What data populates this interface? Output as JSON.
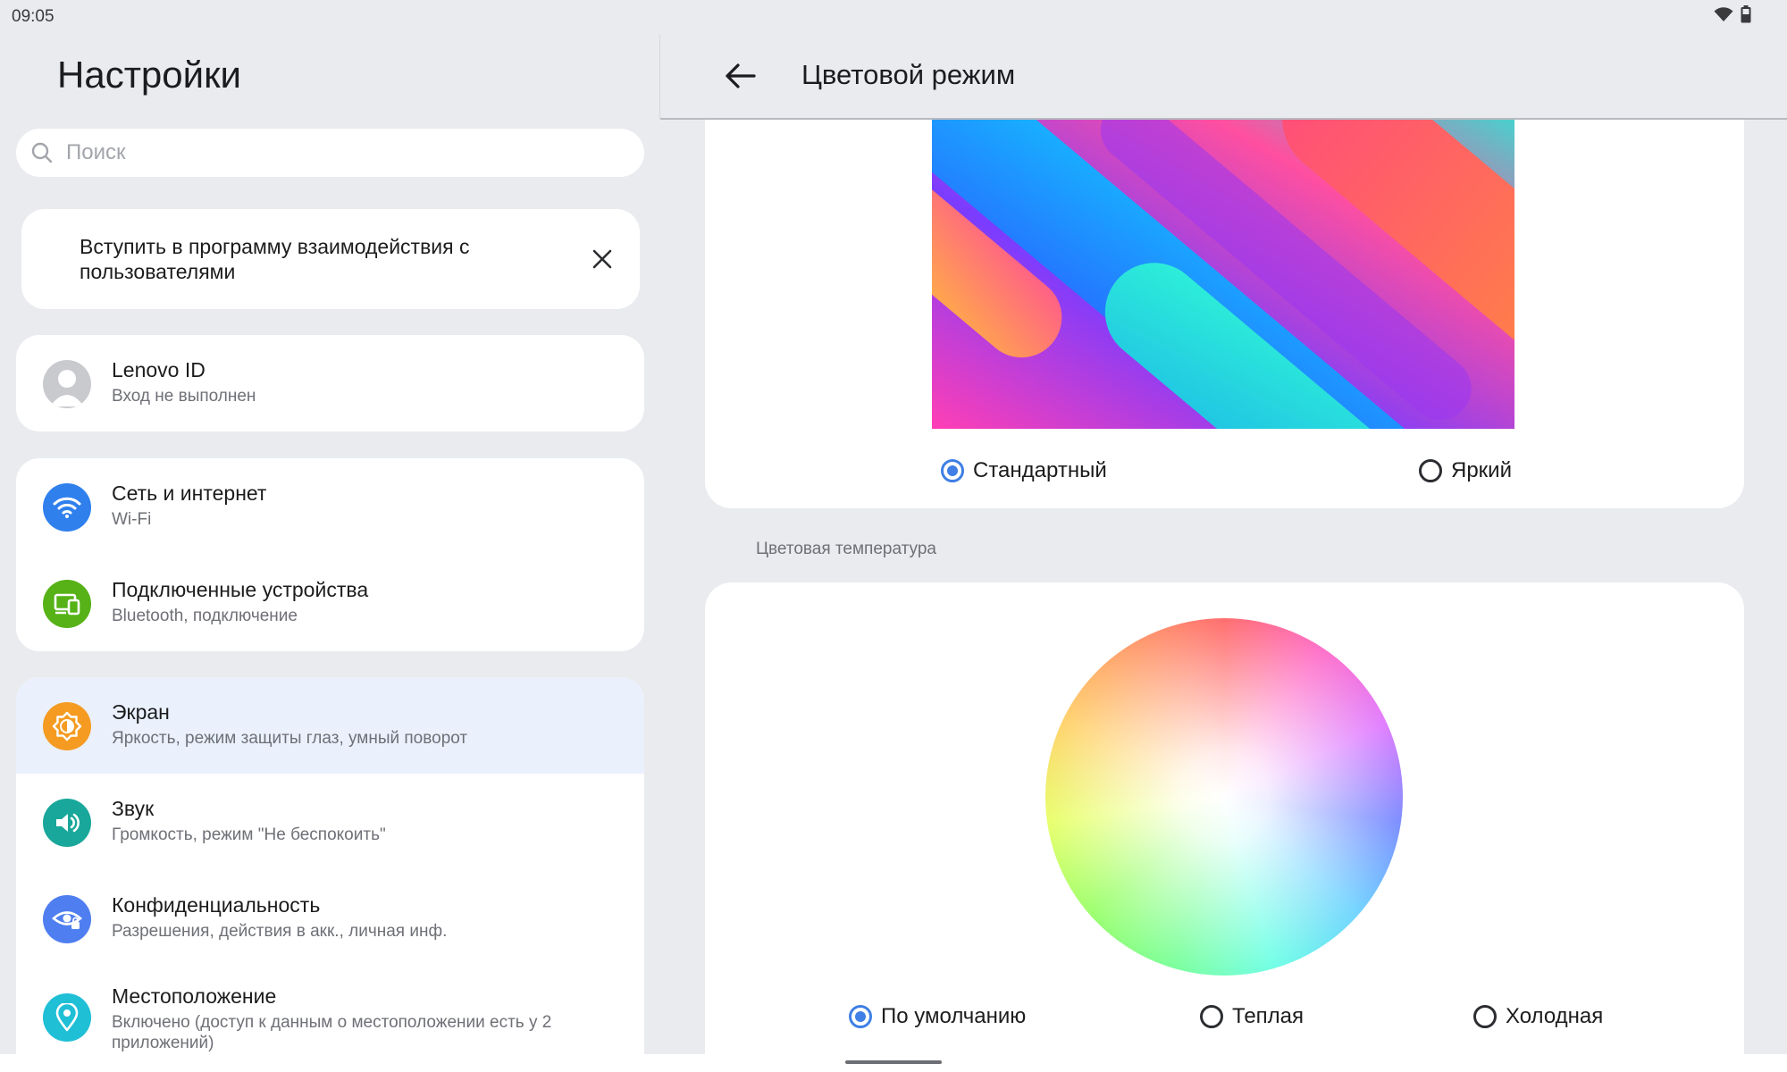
{
  "status": {
    "time": "09:05"
  },
  "settings": {
    "title": "Настройки",
    "search_placeholder": "Поиск",
    "promo": {
      "text": "Вступить в программу взаимодействия с пользователями"
    },
    "account": {
      "title": "Lenovo ID",
      "subtitle": "Вход не выполнен"
    },
    "items": [
      {
        "title": "Сеть и интернет",
        "subtitle": "Wi-Fi",
        "icon": "wifi-icon",
        "color": "#2f80ed"
      },
      {
        "title": "Подключенные устройства",
        "subtitle": "Bluetooth, подключение",
        "icon": "connected-devices-icon",
        "color": "#56b217"
      },
      {
        "title": "Экран",
        "subtitle": "Яркость, режим защиты глаз, умный поворот",
        "icon": "brightness-icon",
        "color": "#f59b22"
      },
      {
        "title": "Звук",
        "subtitle": "Громкость, режим \"Не беспокоить\"",
        "icon": "sound-icon",
        "color": "#18a79a"
      },
      {
        "title": "Конфиденциальность",
        "subtitle": "Разрешения, действия в акк., личная инф.",
        "icon": "privacy-eye-icon",
        "color": "#4f7ef0"
      },
      {
        "title": "Местоположение",
        "subtitle": "Включено (доступ к данным о местоположении есть у 2 приложений)",
        "icon": "location-icon",
        "color": "#1fbfd6"
      }
    ]
  },
  "detail": {
    "title": "Цветовой режим",
    "mode_options": [
      {
        "label": "Стандартный",
        "selected": true
      },
      {
        "label": "Яркий",
        "selected": false
      }
    ],
    "temperature_label": "Цветовая температура",
    "temperature_options": [
      {
        "label": "По умолчанию",
        "selected": true
      },
      {
        "label": "Теплая",
        "selected": false
      },
      {
        "label": "Холодная",
        "selected": false
      }
    ]
  },
  "colors": {
    "accent": "#3f7fe6",
    "active_row": "#eaf1fd",
    "background": "#e9ebef"
  }
}
